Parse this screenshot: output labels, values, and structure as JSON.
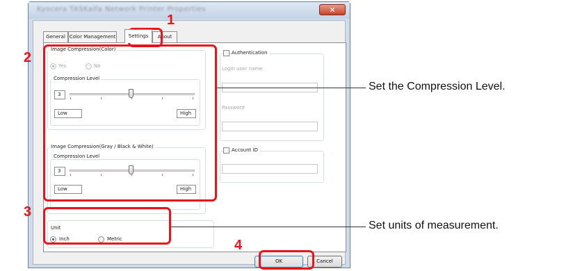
{
  "window": {
    "title": "Kyocera TASKalfa Network Printer Properties",
    "close_label": "✕"
  },
  "tabs": [
    {
      "label": "General"
    },
    {
      "label": "Color Management"
    },
    {
      "label": "Settings"
    },
    {
      "label": "About"
    }
  ],
  "color_compression": {
    "group_label": "Image Compression(Color)",
    "yes_label": "Yes",
    "no_label": "No",
    "level_label": "Compression Level",
    "level_value": "3",
    "low_label": "Low",
    "high_label": "High"
  },
  "gray_compression": {
    "group_label": "Image Compression(Gray / Black & White)",
    "level_label": "Compression Level",
    "level_value": "3",
    "low_label": "Low",
    "high_label": "High"
  },
  "unit": {
    "group_label": "Unit",
    "inch_label": "Inch",
    "metric_label": "Metric"
  },
  "authentication": {
    "checkbox_label": "Authentication",
    "login_label": "Login user name",
    "password_label": "Password"
  },
  "account": {
    "checkbox_label": "Account ID"
  },
  "buttons": {
    "ok": "OK",
    "cancel": "Cancel"
  },
  "callouts": {
    "n1": "1",
    "n2": "2",
    "n3": "3",
    "n4": "4"
  },
  "annotations": {
    "compression_note": "Set the Compression Level.",
    "units_note": "Set units of measurement."
  },
  "colors": {
    "callout_red": "#e8141c",
    "selected_radio": "#2a5ea8"
  }
}
